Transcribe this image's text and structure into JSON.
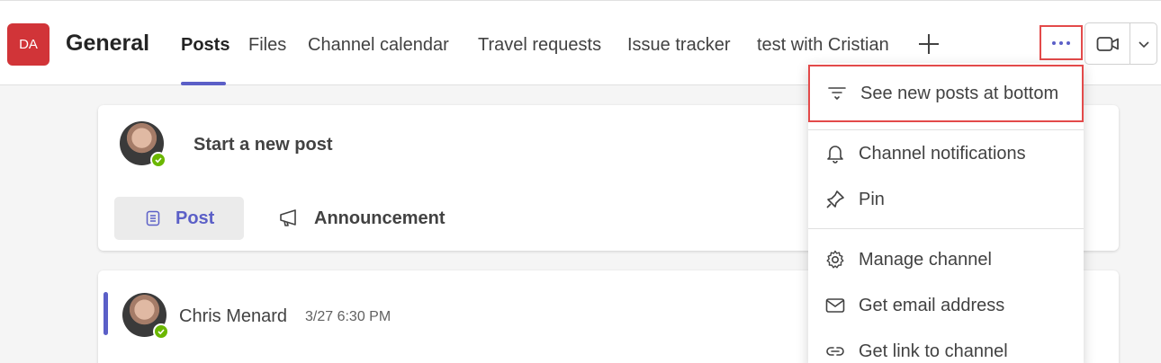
{
  "header": {
    "team_initials": "DA",
    "channel_name": "General",
    "tabs": [
      {
        "label": "Posts",
        "active": true
      },
      {
        "label": "Files"
      },
      {
        "label": "Channel calendar"
      },
      {
        "label": "Travel requests"
      },
      {
        "label": "Issue tracker"
      },
      {
        "label": "test with Cristian"
      }
    ],
    "add_tab_icon": "plus-icon",
    "more_icon": "ellipsis-icon",
    "meet_icon": "video-camera-icon",
    "meet_menu_icon": "chevron-down-icon"
  },
  "compose": {
    "placeholder": "Start a new post",
    "post_label": "Post",
    "announcement_label": "Announcement"
  },
  "messages": [
    {
      "author": "Chris Menard",
      "time": "3/27 6:30 PM"
    }
  ],
  "menu": {
    "items": [
      {
        "label": "See new posts at bottom",
        "icon": "sort-bottom-icon"
      },
      {
        "label": "Channel notifications",
        "icon": "bell-icon"
      },
      {
        "label": "Pin",
        "icon": "pin-icon"
      },
      {
        "label": "Manage channel",
        "icon": "gear-icon"
      },
      {
        "label": "Get email address",
        "icon": "mail-icon"
      },
      {
        "label": "Get link to channel",
        "icon": "link-icon"
      }
    ]
  },
  "colors": {
    "accent": "#5b5fc7",
    "team_avatar": "#d13438",
    "highlight_box": "#e34a4a",
    "presence_available": "#6bb700"
  }
}
